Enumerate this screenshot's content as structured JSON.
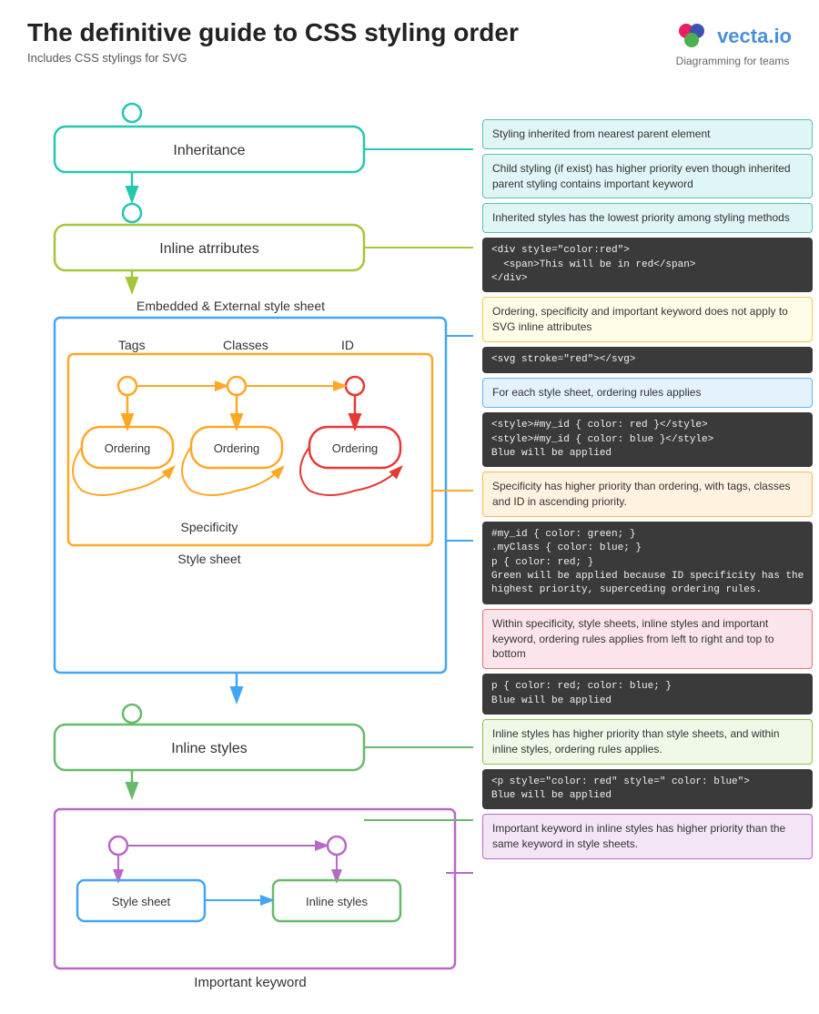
{
  "header": {
    "title": "The definitive guide to CSS styling order",
    "subtitle": "Includes CSS stylings for SVG",
    "logo_text": "vecta.io",
    "logo_sub": "Diagramming for teams"
  },
  "annotations": [
    {
      "id": "ann1",
      "type": "teal",
      "text": "Styling inherited from nearest parent element"
    },
    {
      "id": "ann2",
      "type": "teal",
      "text": "Child styling (if exist) has higher priority even though inherited parent styling contains important keyword"
    },
    {
      "id": "ann3",
      "type": "teal",
      "text": "Inherited styles has the lowest priority among styling methods"
    },
    {
      "id": "ann4",
      "type": "dark",
      "text": "<div style=\"color:red\">\n  <span>This will be in red</span>\n</div>"
    },
    {
      "id": "ann5",
      "type": "yellow",
      "text": "Ordering, specificity and important keyword does not apply to SVG inline attributes"
    },
    {
      "id": "ann6",
      "type": "dark",
      "text": "<svg stroke=\"red\"></svg>"
    },
    {
      "id": "ann7",
      "type": "blue",
      "text": "For each style sheet, ordering rules applies"
    },
    {
      "id": "ann8",
      "type": "dark",
      "text": "<style>#my_id { color: red }</style>\n<style>#my_id { color: blue }</style>\nBlue will be applied"
    },
    {
      "id": "ann9",
      "type": "orange",
      "text": "Specificity has higher priority than ordering, with tags, classes and ID in ascending priority."
    },
    {
      "id": "ann10",
      "type": "dark",
      "text": "#my_id { color: green; }\n.myClass { color: blue; }\np { color: red; }\nGreen will be applied because ID specificity has the highest priority, superceding ordering rules."
    },
    {
      "id": "ann11",
      "type": "red",
      "text": "Within specificity, style sheets, inline styles and important keyword, ordering rules applies from left to right and top to bottom"
    },
    {
      "id": "ann12",
      "type": "dark",
      "text": "p { color: red; color: blue; }\nBlue will be applied"
    },
    {
      "id": "ann13",
      "type": "green-light",
      "text": "Inline styles has higher priority than style sheets, and within inline styles, ordering rules applies."
    },
    {
      "id": "ann14",
      "type": "dark",
      "text": "<p style=\"color: red\" style=\" color: blue\">\nBlue will be applied"
    },
    {
      "id": "ann15",
      "type": "purple",
      "text": "Important keyword in inline styles has higher priority than the same keyword in style sheets."
    }
  ],
  "diagram": {
    "inheritance_label": "Inheritance",
    "inline_attrs_label": "Inline atrributes",
    "embedded_label": "Embedded & External style sheet",
    "tags_label": "Tags",
    "classes_label": "Classes",
    "id_label": "ID",
    "ordering_label": "Ordering",
    "specificity_label": "Specificity",
    "style_sheet_label": "Style sheet",
    "inline_styles_label": "Inline styles",
    "important_label": "Important keyword",
    "style_sheet_inner": "Style sheet",
    "inline_styles_inner": "Inline styles"
  }
}
